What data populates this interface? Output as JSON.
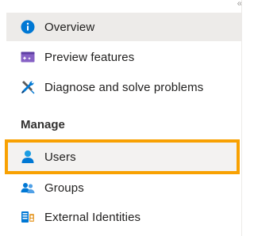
{
  "nav": {
    "overview": {
      "label": "Overview",
      "icon": "info-icon"
    },
    "preview_features": {
      "label": "Preview features",
      "icon": "preview-features-icon"
    },
    "diagnose": {
      "label": "Diagnose and solve problems",
      "icon": "wrench-icon"
    },
    "manage_header": "Manage",
    "users": {
      "label": "Users",
      "icon": "user-icon"
    },
    "groups": {
      "label": "Groups",
      "icon": "groups-icon"
    },
    "external_identities": {
      "label": "External Identities",
      "icon": "external-identities-icon"
    }
  },
  "colors": {
    "selected_bg": "#edebe9",
    "highlight_border": "#f8a102",
    "azure_blue": "#0078d4",
    "purple": "#8661c5"
  }
}
